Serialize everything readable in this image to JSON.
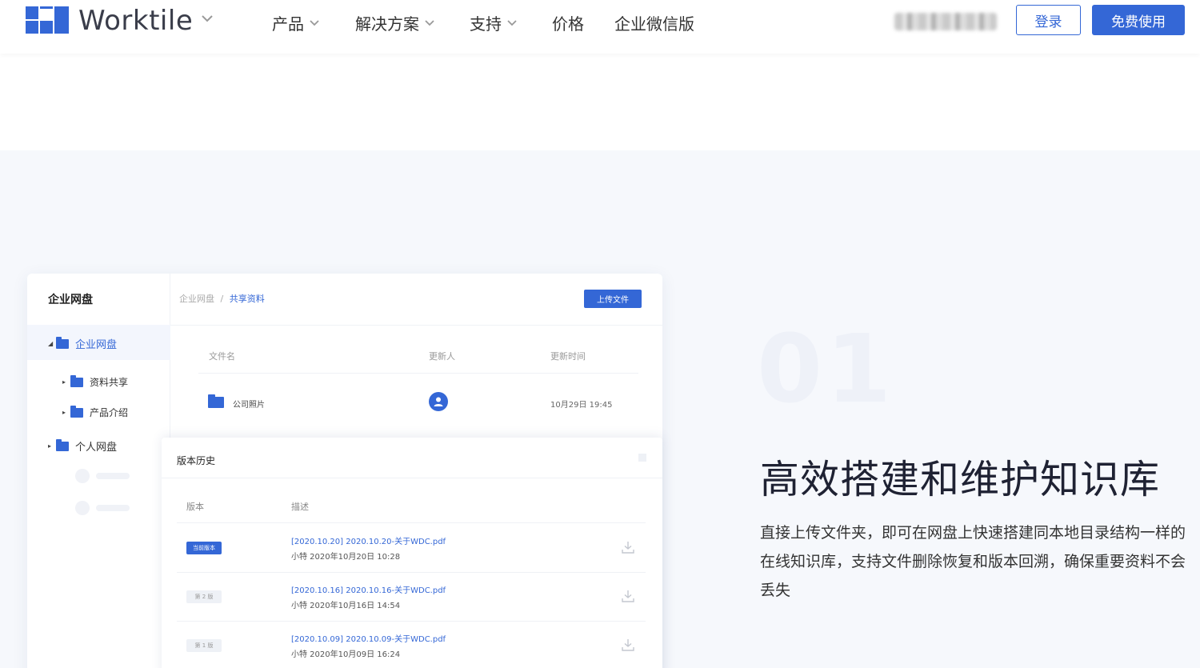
{
  "header": {
    "brand": "Worktile",
    "nav": [
      "产品",
      "解决方案",
      "支持",
      "价格",
      "企业微信版"
    ],
    "login": "登录",
    "free": "免费使用"
  },
  "mockup": {
    "sidebar_title": "企业网盘",
    "tree": {
      "root": "企业网盘",
      "child1": "资料共享",
      "child2": "产品介绍",
      "personal": "个人网盘"
    },
    "breadcrumb_root": "企业网盘",
    "breadcrumb_sep": "/",
    "breadcrumb_current": "共享资料",
    "upload": "上传文件",
    "table_headers": [
      "文件名",
      "更新人",
      "更新时间"
    ],
    "file": {
      "name": "公司照片",
      "time": "10月29日 19:45"
    },
    "versions": {
      "title": "版本历史",
      "headers": [
        "版本",
        "描述"
      ],
      "rows": [
        {
          "badge": "当前版本",
          "file": "[2020.10.20] 2020.10.20-关于WDC.pdf",
          "meta": "小特 2020年10月20日 10:28"
        },
        {
          "badge": "第 2 版",
          "file": "[2020.10.16] 2020.10.16-关于WDC.pdf",
          "meta": "小特 2020年10月16日 14:54"
        },
        {
          "badge": "第 1 版",
          "file": "[2020.10.09] 2020.10.09-关于WDC.pdf",
          "meta": "小特 2020年10月09日 16:24"
        }
      ]
    }
  },
  "feature": {
    "number": "01",
    "title": "高效搭建和维护知识库",
    "description": "直接上传文件夹，即可在网盘上快速搭建同本地目录结构一样的在线知识库，支持文件删除恢复和版本回溯，确保重要资料不会丢失"
  },
  "colors": {
    "primary": "#3467d6",
    "section_bg": "#f6f8fc"
  }
}
